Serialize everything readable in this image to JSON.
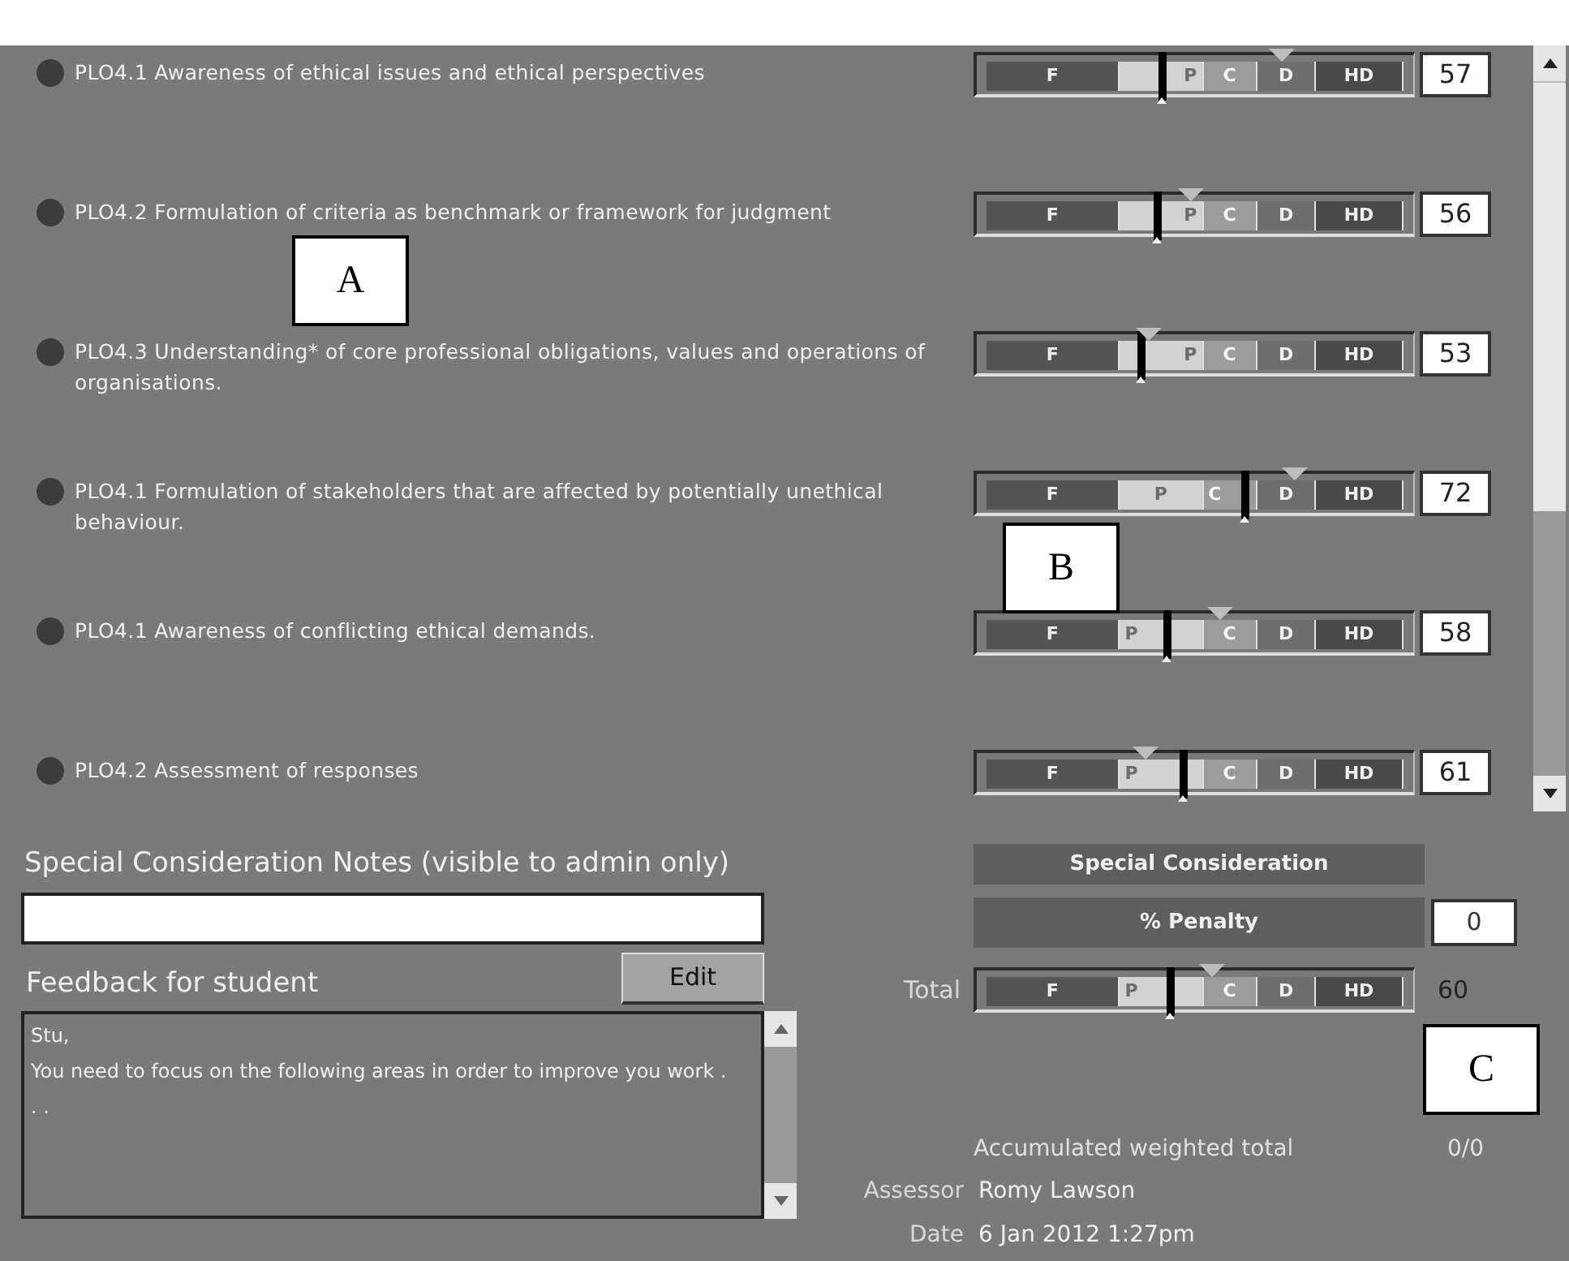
{
  "criteria": [
    {
      "label": "PLO4.1 Awareness of ethical issues and ethical perspectives",
      "segments": [
        "F",
        "P",
        "C",
        "D",
        "HD"
      ],
      "score": {
        "level": 0.42
      },
      "target": {
        "level": 0.71
      },
      "mark": "57"
    },
    {
      "label": "PLO4.2 Formulation of criteria as benchmark or framework for judgment",
      "segments": [
        "F",
        "P",
        "C",
        "D",
        "HD"
      ],
      "score": {
        "level": 0.41
      },
      "target": {
        "level": 0.49
      },
      "mark": "56"
    },
    {
      "label": "PLO4.3 Understanding* of core professional obligations, values and operations of organisations.",
      "segments": [
        "F",
        "P",
        "C",
        "D",
        "HD"
      ],
      "score": {
        "level": 0.37
      },
      "target": {
        "level": 0.39
      },
      "mark": "53"
    },
    {
      "label": "PLO4.1 Formulation of stakeholders that are affected by potentially unethical behaviour.",
      "segments": [
        "F",
        "P",
        "C",
        "D",
        "HD"
      ],
      "score": {
        "level": 0.62
      },
      "target": {
        "level": 0.74
      },
      "mark": "72"
    },
    {
      "label": "PLO4.1 Awareness of conflicting ethical demands.",
      "segments": [
        "F",
        "P",
        "C",
        "D",
        "HD"
      ],
      "score": {
        "level": 0.43
      },
      "target": {
        "level": 0.56
      },
      "mark": "58"
    },
    {
      "label": "PLO4.2 Assessment of responses",
      "segments": [
        "F",
        "P",
        "C",
        "D",
        "HD"
      ],
      "score": {
        "level": 0.47
      },
      "target": {
        "level": 0.38
      },
      "mark": "61"
    }
  ],
  "notes": {
    "label": "Special Consideration Notes (visible to admin only)"
  },
  "feedback": {
    "label": "Feedback for student",
    "edit_button": "Edit",
    "lines": [
      "Stu,",
      "You need to focus on the following areas in order to improve you work . . ."
    ]
  },
  "special_consideration": {
    "heading": "Special Consideration",
    "penalty_label": "% Penalty",
    "penalty_value": "0"
  },
  "total": {
    "label": "Total",
    "segments": [
      "F",
      "P",
      "C",
      "D",
      "HD"
    ],
    "score": {
      "level": 0.44
    },
    "target": {
      "level": 0.54
    },
    "value": "60"
  },
  "accumulated": {
    "label": "Accumulated weighted total",
    "value": "0/0"
  },
  "assessor": {
    "label": "Assessor",
    "value": "Romy Lawson"
  },
  "date": {
    "label": "Date",
    "value": "6 Jan 2012 1:27pm"
  },
  "callouts": [
    "A",
    "B",
    "C"
  ]
}
